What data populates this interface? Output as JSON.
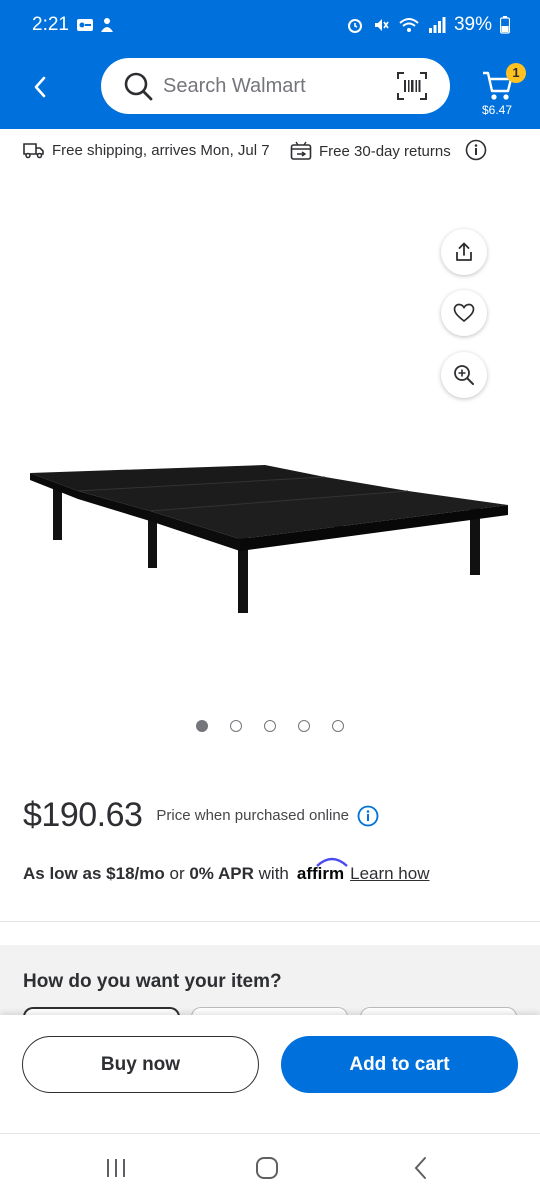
{
  "status_bar": {
    "time": "2:21",
    "battery": "39%"
  },
  "header": {
    "search_placeholder": "Search Walmart",
    "cart_count": "1",
    "cart_total": "$6.47"
  },
  "info_row": {
    "shipping": "Free shipping, arrives Mon, Jul 7",
    "returns": "Free 30-day returns"
  },
  "gallery": {
    "image_count": 5,
    "active_index": 0
  },
  "product": {
    "price": "$190.63",
    "price_note": "Price when purchased online"
  },
  "financing": {
    "prefix": "As low as",
    "monthly": "$18/mo",
    "or": "or",
    "apr": "0% APR",
    "with": "with",
    "provider": "affirm",
    "learn_how": "Learn how"
  },
  "fulfillment": {
    "title": "How do you want your item?"
  },
  "actions": {
    "buy_now": "Buy now",
    "add_to_cart": "Add to cart"
  },
  "colors": {
    "brand_blue": "#0071dc",
    "spark_yellow": "#ffc220"
  }
}
